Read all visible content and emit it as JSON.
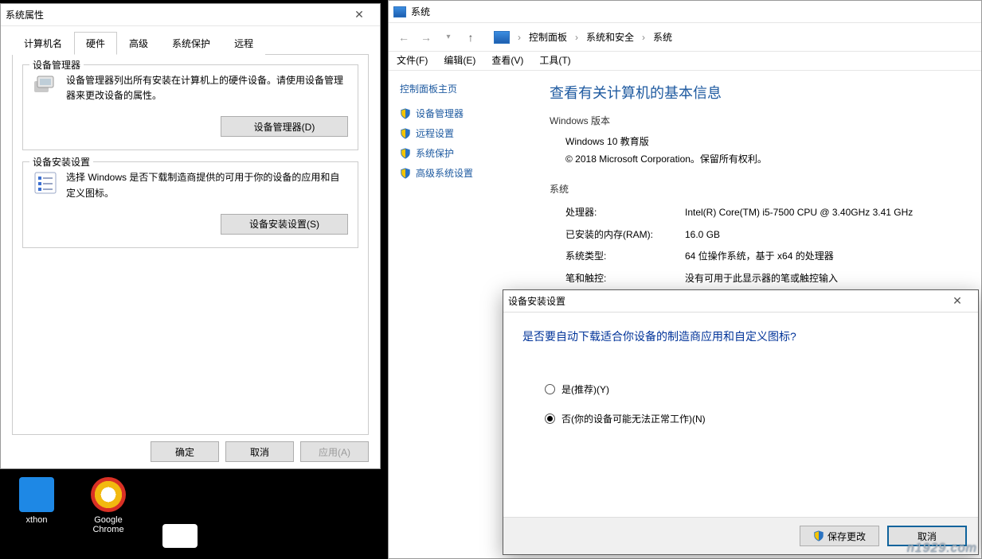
{
  "props_dialog": {
    "title": "系统属性",
    "tabs": [
      "计算机名",
      "硬件",
      "高级",
      "系统保护",
      "远程"
    ],
    "active_tab": 1,
    "group1": {
      "title": "设备管理器",
      "text": "设备管理器列出所有安装在计算机上的硬件设备。请使用设备管理器来更改设备的属性。",
      "button": "设备管理器(D)"
    },
    "group2": {
      "title": "设备安装设置",
      "text": "选择 Windows 是否下载制造商提供的可用于你的设备的应用和自定义图标。",
      "button": "设备安装设置(S)"
    },
    "footer": {
      "ok": "确定",
      "cancel": "取消",
      "apply": "应用(A)"
    }
  },
  "sys_window": {
    "title": "系统",
    "breadcrumbs": [
      "控制面板",
      "系统和安全",
      "系统"
    ],
    "menus": [
      "文件(F)",
      "编辑(E)",
      "查看(V)",
      "工具(T)"
    ],
    "side_heading": "控制面板主页",
    "side_links": [
      "设备管理器",
      "远程设置",
      "系统保护",
      "高级系统设置"
    ],
    "main_heading": "查看有关计算机的基本信息",
    "win_section": {
      "title": "Windows 版本",
      "edition": "Windows 10 教育版",
      "copyright": "© 2018 Microsoft Corporation。保留所有权利。"
    },
    "hw_section": {
      "title": "系统",
      "rows": [
        {
          "k": "处理器:",
          "v": "Intel(R) Core(TM) i5-7500 CPU @ 3.40GHz   3.41 GHz"
        },
        {
          "k": "已安装的内存(RAM):",
          "v": "16.0 GB"
        },
        {
          "k": "系统类型:",
          "v": "64 位操作系统，基于 x64 的处理器"
        },
        {
          "k": "笔和触控:",
          "v": "没有可用于此显示器的笔或触控输入"
        }
      ]
    }
  },
  "install_dialog": {
    "title": "设备安装设置",
    "question": "是否要自动下载适合你设备的制造商应用和自定义图标?",
    "opt_yes": "是(推荐)(Y)",
    "opt_no": "否(你的设备可能无法正常工作)(N)",
    "save": "保存更改",
    "cancel": "取消"
  },
  "desktop": {
    "icons": [
      {
        "label": "xthon",
        "color": "#1e88e5"
      },
      {
        "label": "Google Chrome",
        "color": "#ffffff"
      }
    ]
  },
  "watermark": "n1929.com"
}
